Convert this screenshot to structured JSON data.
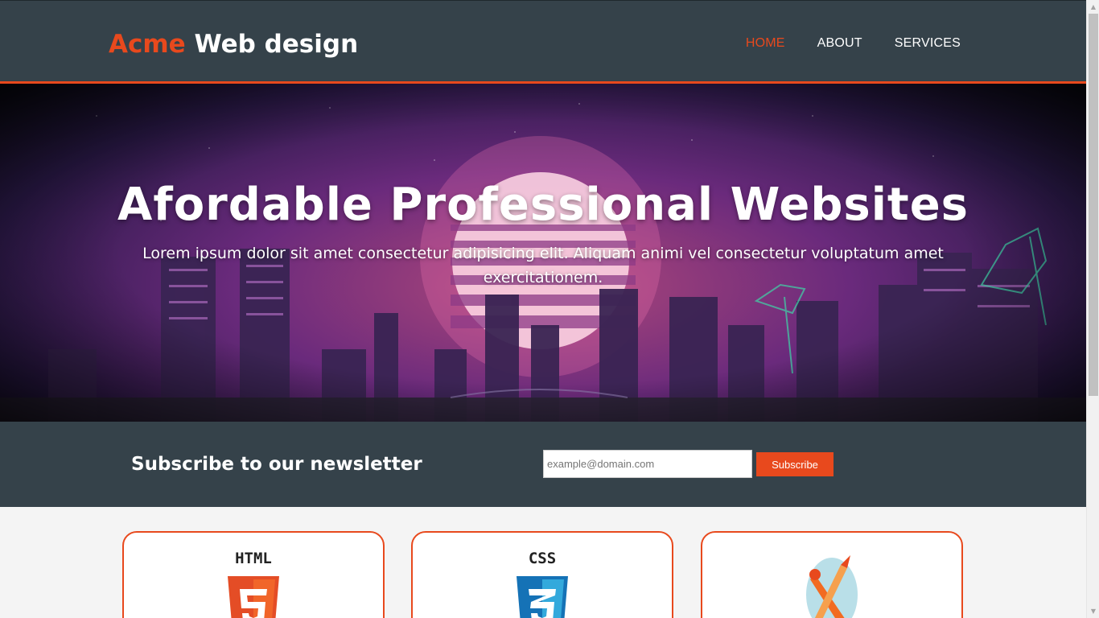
{
  "header": {
    "brand_highlight": "Acme",
    "brand_rest": " Web design",
    "nav": [
      {
        "label": "HOME",
        "current": true
      },
      {
        "label": "ABOUT",
        "current": false
      },
      {
        "label": "SERVICES",
        "current": false
      }
    ]
  },
  "showcase": {
    "title": "Afordable Professional Websites",
    "text": "Lorem ipsum dolor sit amet consectetur adipisicing elit. Aliquam animi vel consectetur voluptatum amet exercitationem."
  },
  "newsletter": {
    "heading": "Subscribe to our newsletter",
    "email_placeholder": "example@domain.com",
    "email_value": "",
    "button_label": "Subscribe"
  },
  "boxes": [
    {
      "icon": "html5-logo-icon",
      "logo_text": "HTML"
    },
    {
      "icon": "css3-logo-icon",
      "logo_text": "CSS"
    },
    {
      "icon": "paintbrush-pencil-icon"
    }
  ],
  "colors": {
    "accent": "#e8491d",
    "dark": "#35424a",
    "background": "#f4f4f4"
  }
}
